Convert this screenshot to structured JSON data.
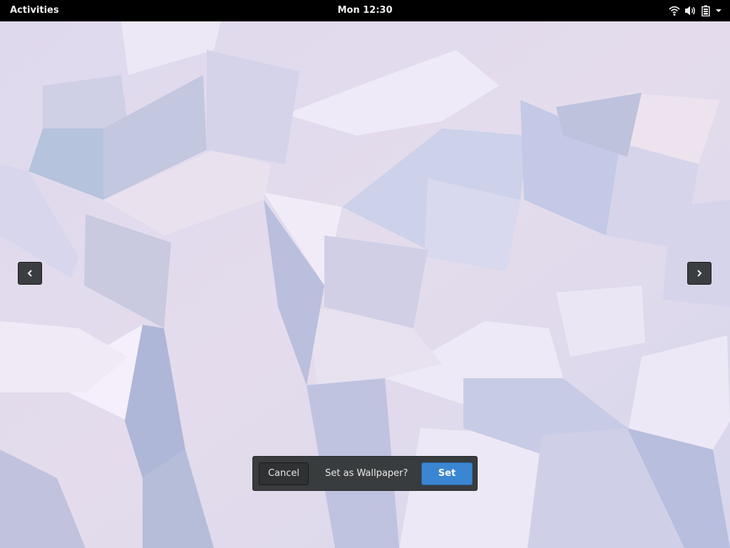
{
  "topbar": {
    "activities_label": "Activities",
    "clock": "Mon 12:30",
    "tray_icons": [
      "wifi-icon",
      "volume-icon",
      "battery-icon",
      "dropdown-arrow-icon"
    ]
  },
  "viewer": {
    "prev_icon": "chevron-left-icon",
    "next_icon": "chevron-right-icon"
  },
  "dialog": {
    "cancel_label": "Cancel",
    "prompt": "Set as Wallpaper?",
    "set_label": "Set"
  },
  "colors": {
    "topbar_bg": "#000000",
    "set_button": "#3b86d2",
    "nav_button": "#3b3e40"
  }
}
